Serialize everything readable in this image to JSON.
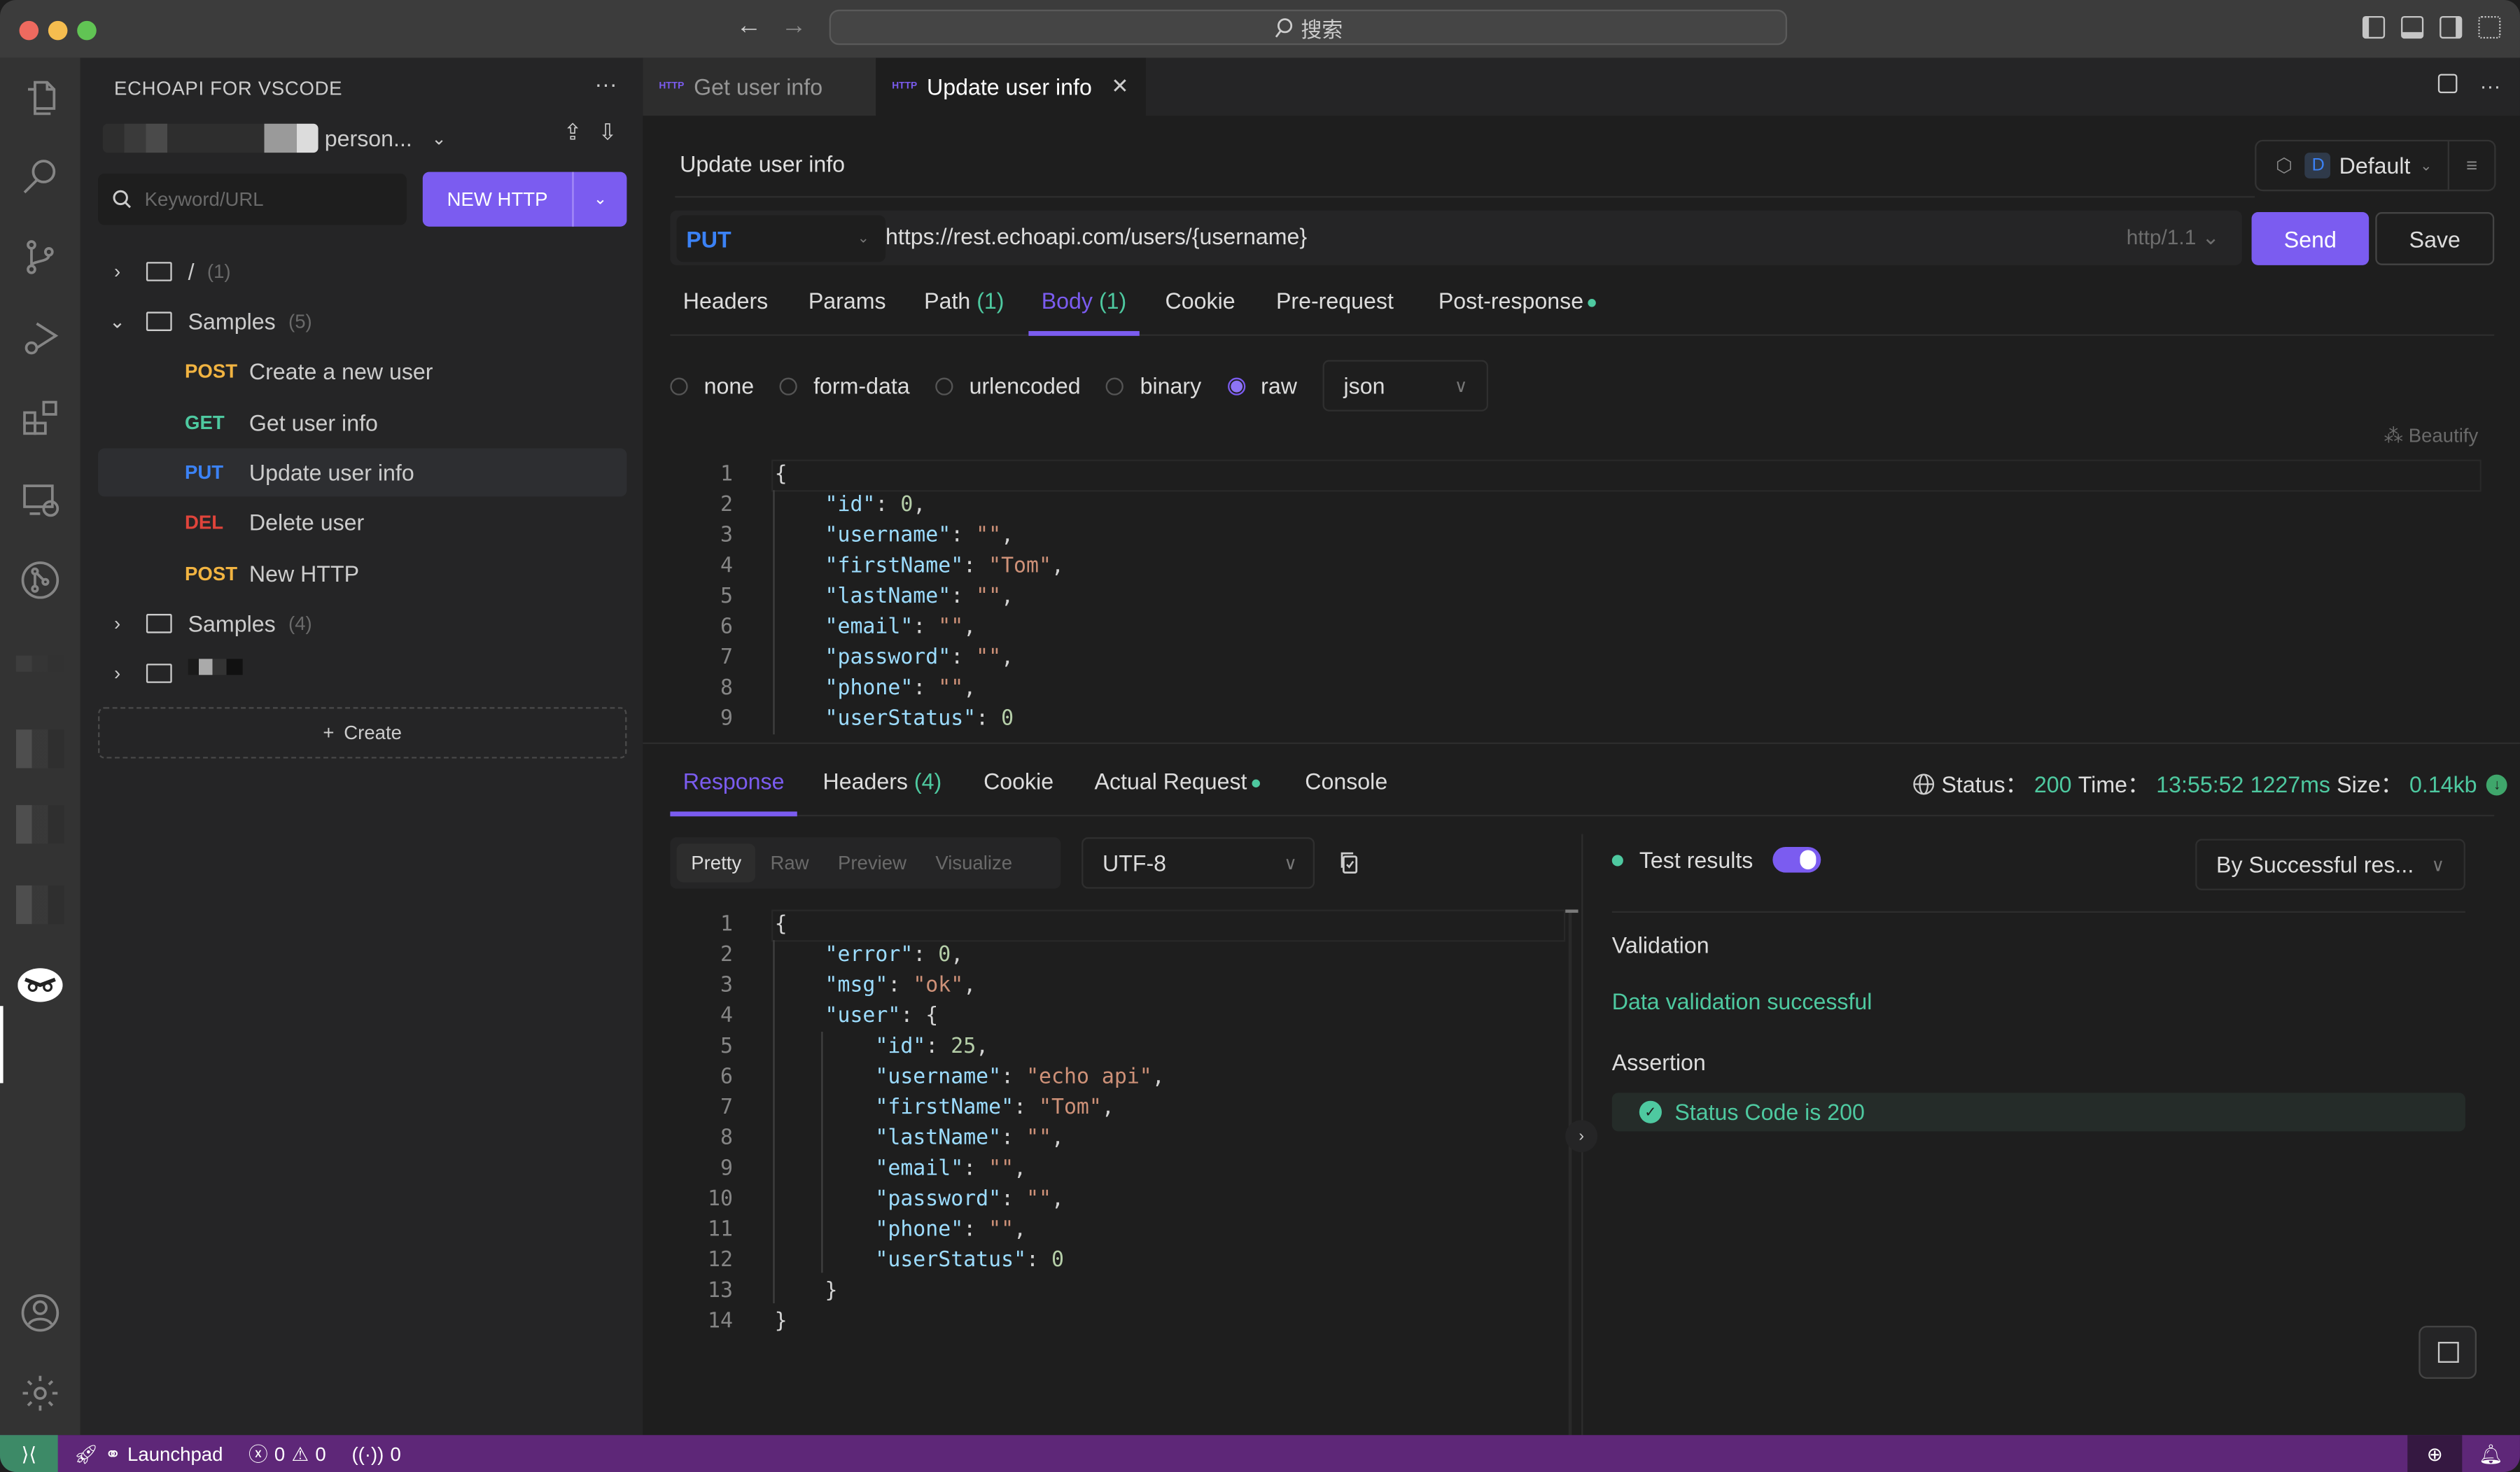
{
  "titlebar": {
    "search_placeholder": "搜索"
  },
  "sidebar": {
    "title": "ECHOAPI FOR VSCODE",
    "workspace_name": "person...",
    "search_placeholder": "Keyword/URL",
    "new_http_label": "NEW HTTP",
    "tree": [
      {
        "type": "folder",
        "name": "/",
        "count": "(1)",
        "expanded": false
      },
      {
        "type": "folder",
        "name": "Samples",
        "count": "(5)",
        "expanded": true
      },
      {
        "type": "request",
        "method": "POST",
        "name": "Create a new user"
      },
      {
        "type": "request",
        "method": "GET",
        "name": "Get user info"
      },
      {
        "type": "request",
        "method": "PUT",
        "name": "Update user info",
        "selected": true
      },
      {
        "type": "request",
        "method": "DEL",
        "name": "Delete user"
      },
      {
        "type": "request",
        "method": "POST",
        "name": "New HTTP"
      },
      {
        "type": "folder",
        "name": "Samples",
        "count": "(4)",
        "expanded": false
      },
      {
        "type": "folder",
        "name": "",
        "count": "",
        "expanded": false
      }
    ],
    "create_label": "Create"
  },
  "tabs": [
    {
      "tag": "HTTP",
      "label": "Get user info",
      "active": false
    },
    {
      "tag": "HTTP",
      "label": "Update user info",
      "active": true
    }
  ],
  "request": {
    "title": "Update user info",
    "environment": {
      "badge": "D",
      "name": "Default"
    },
    "method": "PUT",
    "url": "https://rest.echoapi.com/users/{username}",
    "protocol": "http/1.1",
    "send_label": "Send",
    "save_label": "Save",
    "tabs": [
      {
        "label": "Headers",
        "count": ""
      },
      {
        "label": "Params",
        "count": ""
      },
      {
        "label": "Path",
        "count": "(1)"
      },
      {
        "label": "Body",
        "count": "(1)",
        "active": true
      },
      {
        "label": "Cookie",
        "count": ""
      },
      {
        "label": "Pre-request",
        "count": ""
      },
      {
        "label": "Post-response",
        "count": "",
        "dot": true
      }
    ],
    "body_types": [
      {
        "label": "none",
        "checked": false
      },
      {
        "label": "form-data",
        "checked": false
      },
      {
        "label": "urlencoded",
        "checked": false
      },
      {
        "label": "binary",
        "checked": false
      },
      {
        "label": "raw",
        "checked": true
      }
    ],
    "raw_format": "json",
    "beautify_label": "Beautify",
    "body_lines": [
      "{",
      "    \"id\": 0,",
      "    \"username\": \"\",",
      "    \"firstName\": \"Tom\",",
      "    \"lastName\": \"\",",
      "    \"email\": \"\",",
      "    \"password\": \"\",",
      "    \"phone\": \"\",",
      "    \"userStatus\": 0"
    ]
  },
  "response": {
    "tabs": [
      {
        "label": "Response",
        "count": "",
        "active": true
      },
      {
        "label": "Headers",
        "count": "(4)"
      },
      {
        "label": "Cookie",
        "count": ""
      },
      {
        "label": "Actual Request",
        "count": "",
        "dot": true
      },
      {
        "label": "Console",
        "count": ""
      }
    ],
    "status_label": "Status：",
    "status_value": "200",
    "time_label": "Time：",
    "time_value": "13:55:52",
    "duration": "1227ms",
    "size_label": "Size：",
    "size_value": "0.14kb",
    "view_modes": [
      "Pretty",
      "Raw",
      "Preview",
      "Visualize"
    ],
    "active_view": "Pretty",
    "encoding": "UTF-8",
    "body_lines": [
      "{",
      "    \"error\": 0,",
      "    \"msg\": \"ok\",",
      "    \"user\": {",
      "        \"id\": 25,",
      "        \"username\": \"echo api\",",
      "        \"firstName\": \"Tom\",",
      "        \"lastName\": \"\",",
      "        \"email\": \"\",",
      "        \"password\": \"\",",
      "        \"phone\": \"\",",
      "        \"userStatus\": 0",
      "    }",
      "}"
    ],
    "tests": {
      "title": "Test results",
      "toggle_on": true,
      "filter": "By Successful res...",
      "validation_title": "Validation",
      "validation_result": "Data validation successful",
      "assertion_title": "Assertion",
      "assertions": [
        "Status Code is 200"
      ]
    }
  },
  "statusbar": {
    "launchpad_label": "Launchpad",
    "errors": "0",
    "warnings": "0",
    "ports": "0"
  },
  "colors": {
    "accent": "#7b5cf0",
    "success": "#4ec9a0",
    "post": "#f2b441",
    "get": "#4ec9a0",
    "put": "#3b82f6",
    "del": "#e0443b",
    "statusbar": "#5e2778"
  }
}
